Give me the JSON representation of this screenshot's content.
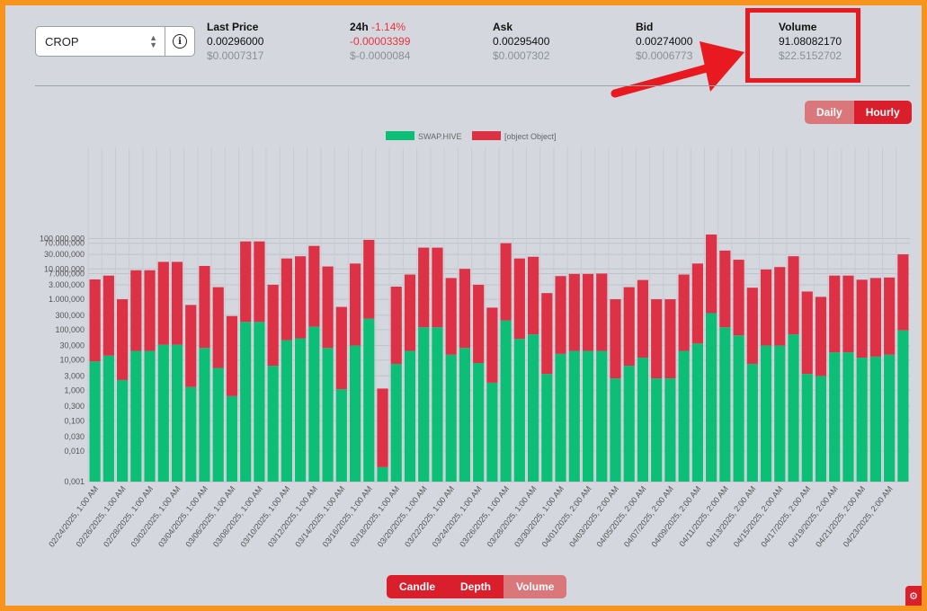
{
  "token_select": {
    "value": "CROP"
  },
  "stats": {
    "last_price": {
      "label": "Last Price",
      "value": "0.00296000",
      "usd": "$0.0007317"
    },
    "change_24h": {
      "label": "24h",
      "pct": "-1.14%",
      "value": "-0.00003399",
      "usd": "$-0.0000084"
    },
    "ask": {
      "label": "Ask",
      "value": "0.00295400",
      "usd": "$0.0007302"
    },
    "bid": {
      "label": "Bid",
      "value": "0.00274000",
      "usd": "$0.0006773"
    },
    "volume": {
      "label": "Volume",
      "value": "91.08082170",
      "usd": "$22.5152702"
    }
  },
  "period_buttons": {
    "daily": "Daily",
    "hourly": "Hourly",
    "selected": "Hourly"
  },
  "view_buttons": {
    "candle": "Candle",
    "depth": "Depth",
    "volume": "Volume",
    "selected": "Volume"
  },
  "colors": {
    "swap_hive": "#0dbf76",
    "other": "#dd3246",
    "accent": "#d91f2c",
    "highlight": "#e8191f",
    "frame": "#f7941d"
  },
  "chart_data": {
    "type": "bar",
    "stacked": true,
    "y_scale": "log",
    "ylim": [
      0.001,
      100000000
    ],
    "grid": true,
    "legend_position": "top-center",
    "y_ticks": [
      {
        "value": 0.001,
        "label": "0,001"
      },
      {
        "value": 0.01,
        "label": "0,010"
      },
      {
        "value": 0.03,
        "label": "0,030"
      },
      {
        "value": 0.1,
        "label": "0,100"
      },
      {
        "value": 0.3,
        "label": "0,300"
      },
      {
        "value": 1,
        "label": "1,000"
      },
      {
        "value": 3,
        "label": "3,000"
      },
      {
        "value": 10,
        "label": "10,000"
      },
      {
        "value": 30,
        "label": "30,000"
      },
      {
        "value": 100,
        "label": "100,000"
      },
      {
        "value": 300,
        "label": "300,000"
      },
      {
        "value": 1000,
        "label": "1.000,000"
      },
      {
        "value": 3000,
        "label": "3.000,000"
      },
      {
        "value": 7000,
        "label": "7.000,000"
      },
      {
        "value": 10000,
        "label": "10.000,000"
      },
      {
        "value": 30000,
        "label": "30.000,000"
      },
      {
        "value": 70000,
        "label": "70.000,000"
      },
      {
        "value": 100000,
        "label": "100.000,000"
      }
    ],
    "x_tick_labels": [
      "02/24/2025, 1:00 AM",
      "02/26/2025, 1:00 AM",
      "02/28/2025, 1:00 AM",
      "03/02/2025, 1:00 AM",
      "03/04/2025, 1:00 AM",
      "03/06/2025, 1:00 AM",
      "03/08/2025, 1:00 AM",
      "03/10/2025, 1:00 AM",
      "03/12/2025, 1:00 AM",
      "03/14/2025, 1:00 AM",
      "03/16/2025, 1:00 AM",
      "03/18/2025, 1:00 AM",
      "03/20/2025, 1:00 AM",
      "03/22/2025, 1:00 AM",
      "03/24/2025, 1:00 AM",
      "03/26/2025, 1:00 AM",
      "03/28/2025, 1:00 AM",
      "03/30/2025, 1:00 AM",
      "04/01/2025, 2:00 AM",
      "04/03/2025, 2:00 AM",
      "04/05/2025, 2:00 AM",
      "04/07/2025, 2:00 AM",
      "04/09/2025, 2:00 AM",
      "04/11/2025, 2:00 AM",
      "04/13/2025, 2:00 AM",
      "04/15/2025, 2:00 AM",
      "04/17/2025, 2:00 AM",
      "04/19/2025, 2:00 AM",
      "04/21/2025, 2:00 AM",
      "04/23/2025, 2:00 AM"
    ],
    "series": [
      {
        "name": "SWAP.HIVE",
        "color": "#0dbf76",
        "values": [
          9,
          14,
          2.2,
          20,
          20,
          32,
          32,
          1.3,
          25,
          5.5,
          0.65,
          180,
          180,
          6.5,
          45,
          52,
          125,
          25,
          1.1,
          30,
          230,
          0.002,
          7.5,
          20,
          120,
          120,
          15,
          25,
          8,
          1.8,
          200,
          50,
          70,
          3.5,
          16,
          20,
          20,
          20,
          2.5,
          6.5,
          12,
          2.5,
          2.5,
          20,
          35,
          350,
          120,
          65,
          7.5,
          30,
          30,
          70,
          3.5,
          3,
          18,
          18,
          12,
          13,
          15,
          95
        ]
      },
      {
        "name": "[object Object]",
        "color": "#dd3246",
        "values": [
          4500,
          6000,
          1000,
          9000,
          9000,
          17000,
          17000,
          650,
          12500,
          2500,
          280,
          80000,
          80000,
          3000,
          22000,
          26000,
          57000,
          12000,
          560,
          15000,
          90000,
          1.15,
          2600,
          6500,
          50000,
          50000,
          5000,
          10000,
          3000,
          530,
          70000,
          22000,
          25000,
          1600,
          5800,
          6800,
          6800,
          7000,
          1000,
          2500,
          4300,
          1000,
          1000,
          6500,
          15000,
          135000,
          40000,
          20000,
          2400,
          9500,
          11500,
          26000,
          1800,
          1200,
          6000,
          6000,
          4400,
          5000,
          5200,
          30000
        ]
      }
    ]
  }
}
